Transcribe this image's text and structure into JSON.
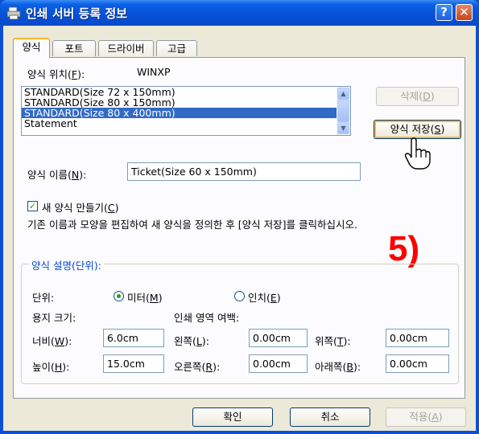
{
  "window": {
    "title": "인쇄 서버 등록 정보",
    "help_btn": "?",
    "close_btn": "✕"
  },
  "tabs": [
    "양식",
    "포트",
    "드라이버",
    "고급"
  ],
  "forms": {
    "location_label_pre": "양식 위치(",
    "location_label_key": "F",
    "location_label_post": "):",
    "location_value": "WINXP",
    "list": [
      "STANDARD(Size 72 x 150mm)",
      "STANDARD(Size 80 x 150mm)",
      "STANDARD(Size 80 x 400mm)",
      "Statement"
    ],
    "selected_index": 2,
    "delete_pre": "삭제(",
    "delete_key": "D",
    "delete_post": ")",
    "save_pre": "양식 저장(",
    "save_key": "S",
    "save_post": ")",
    "name_label_pre": "양식 이름(",
    "name_label_key": "N",
    "name_label_post": "):",
    "name_value": "Ticket(Size 60 x 150mm)",
    "new_form_pre": "새 양식 만들기(",
    "new_form_key": "C",
    "new_form_post": ")",
    "new_form_checked": true,
    "instruction": "기존 이름과 모양을 편집하여 새 양식을 정의한 후 [양식 저장]를 클릭하십시오.",
    "step_marker": "5)"
  },
  "description": {
    "group_title": "양식 설명(단위):",
    "unit_label": "단위:",
    "metric_pre": "미터(",
    "metric_key": "M",
    "metric_post": ")",
    "inch_pre": "인치(",
    "inch_key": "E",
    "inch_post": ")",
    "selected_unit": "metric",
    "paper_size_label": "용지 크기:",
    "margin_label": "인쇄 영역 여백:",
    "width_pre": "너비(",
    "width_key": "W",
    "width_post": "):",
    "width_value": "6.0cm",
    "height_pre": "높이(",
    "height_key": "H",
    "height_post": "):",
    "height_value": "15.0cm",
    "left_pre": "왼쪽(",
    "left_key": "L",
    "left_post": "):",
    "left_value": "0.00cm",
    "right_pre": "오른쪽(",
    "right_key": "R",
    "right_post": "):",
    "right_value": "0.00cm",
    "top_pre": "위쪽(",
    "top_key": "T",
    "top_post": "):",
    "top_value": "0.00cm",
    "bottom_pre": "아래쪽(",
    "bottom_key": "B",
    "bottom_post": "):",
    "bottom_value": "0.00cm"
  },
  "footer": {
    "ok": "확인",
    "cancel": "취소",
    "apply_pre": "적용(",
    "apply_key": "A",
    "apply_post": ")"
  },
  "colors": {
    "titlebar": "#0651d8",
    "selection": "#316ac5",
    "step_marker": "#ff0000",
    "group_title": "#0046d5"
  }
}
